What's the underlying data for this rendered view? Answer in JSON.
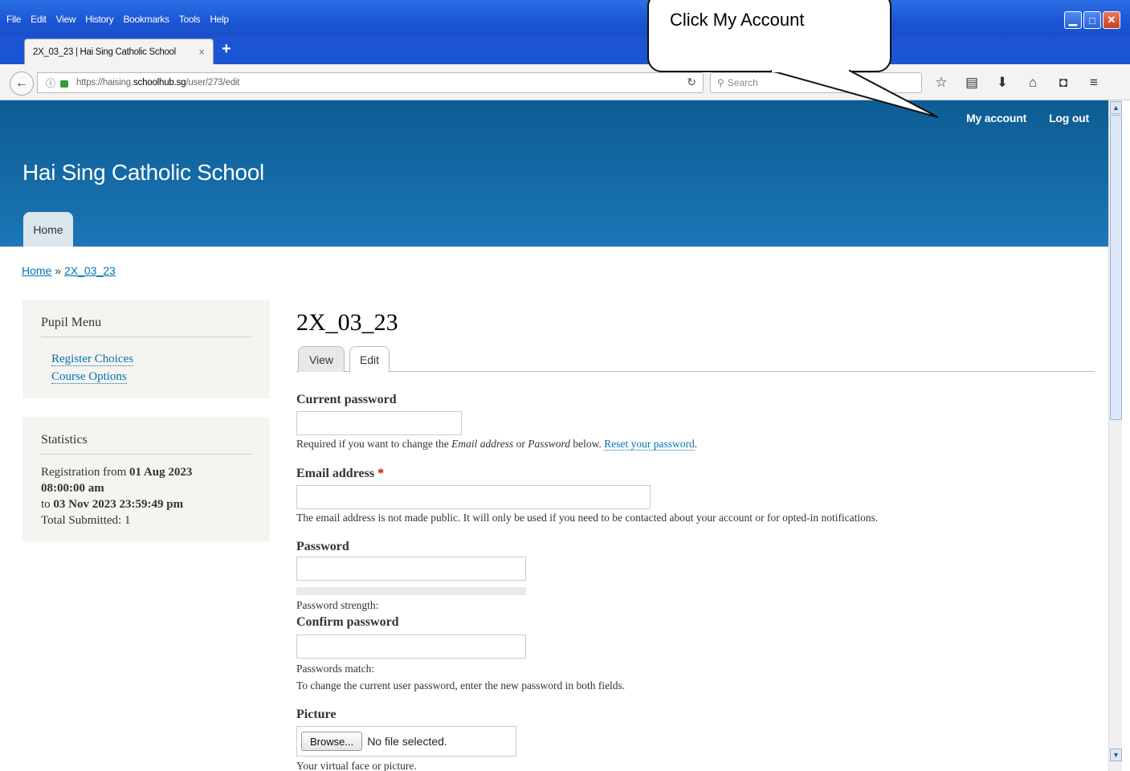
{
  "browser": {
    "menu": [
      "File",
      "Edit",
      "View",
      "History",
      "Bookmarks",
      "Tools",
      "Help"
    ],
    "tab_title": "2X_03_23 | Hai Sing Catholic School",
    "tab_close": "×",
    "new_tab": "+",
    "url_prefix": "https://haising.",
    "url_domain": "schoolhub.sg",
    "url_path": "/user/273/edit",
    "search_placeholder": "Search"
  },
  "annotation": {
    "callout_text": "Click My Account"
  },
  "header": {
    "secondary_menu": [
      "My account",
      "Log out"
    ],
    "site_name": "Hai Sing Catholic School",
    "main_menu_home": "Home"
  },
  "breadcrumb": {
    "home": "Home",
    "separator": "»",
    "current": "2X_03_23"
  },
  "sidebar": {
    "pupil_menu": {
      "title": "Pupil Menu",
      "items": [
        "Register Choices",
        "Course Options"
      ]
    },
    "statistics": {
      "title": "Statistics",
      "registration_prefix": "Registration from",
      "from_date": "01 Aug 2023",
      "from_time": "08:00:00 am",
      "to_prefix": "to",
      "to_datetime": "03 Nov 2023 23:59:49 pm",
      "total_submitted": "Total Submitted: 1"
    }
  },
  "content": {
    "title": "2X_03_23",
    "tabs": [
      "View",
      "Edit"
    ],
    "current_password_label": "Current password",
    "current_password_desc_1": "Required if you want to change the",
    "current_password_desc_email": "Email address",
    "current_password_desc_or": "or",
    "current_password_desc_password": "Password",
    "current_password_desc_2": "below.",
    "reset_link": "Reset your password",
    "email_label": "Email address",
    "required_marker": "*",
    "email_desc": "The email address is not made public. It will only be used if you need to be contacted about your account or for opted-in notifications.",
    "password_label": "Password",
    "password_strength": "Password strength:",
    "confirm_label": "Confirm password",
    "passwords_match": "Passwords match:",
    "password_help": "To change the current user password, enter the new password in both fields.",
    "picture_label": "Picture",
    "browse_button": "Browse...",
    "no_file": "No file selected.",
    "picture_desc": "Your virtual face or picture."
  },
  "colors": {
    "header_top": "#0e5c93",
    "header_bottom": "#1a77b7",
    "link": "#0071b3",
    "sidebar_bg": "#f5f4f0"
  }
}
